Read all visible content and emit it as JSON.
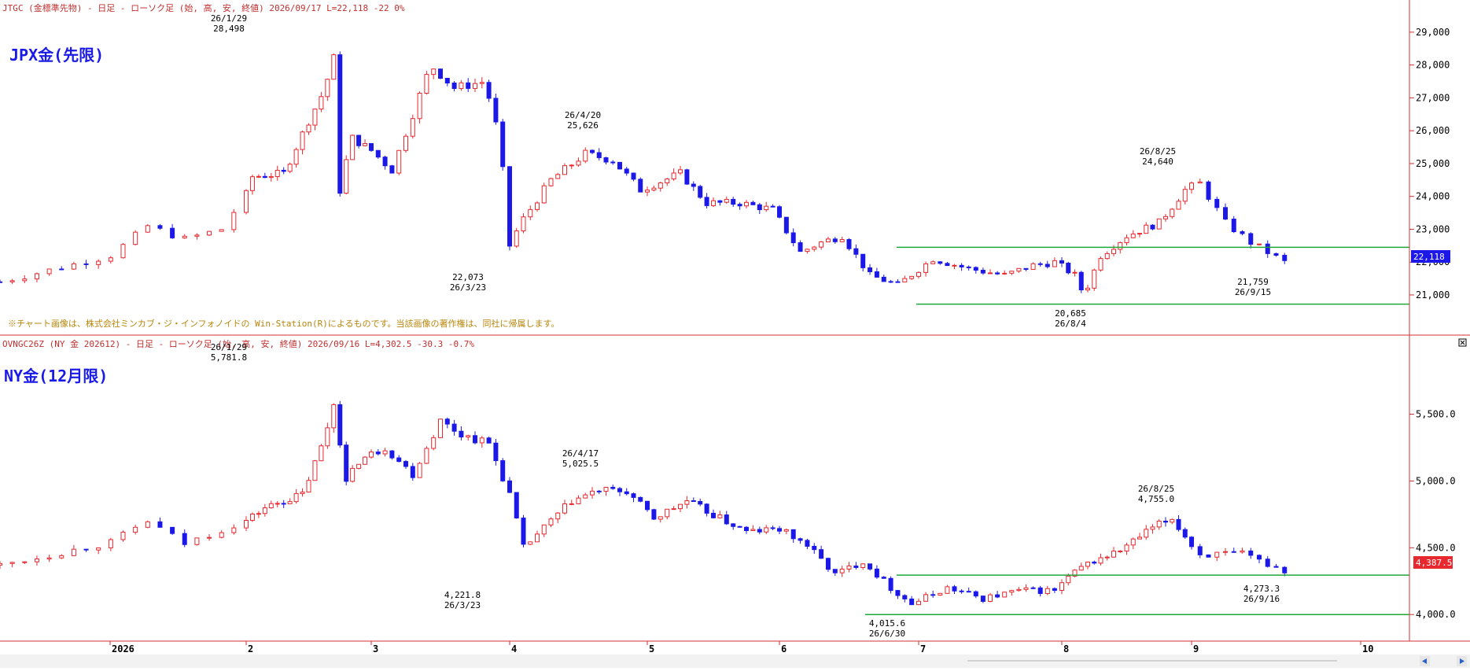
{
  "colors": {
    "up": "#e8282f",
    "down": "#1b18e8",
    "support": "#1fa83a",
    "divider": "#d23232",
    "title": "#1a1ae6",
    "header": "#c03030",
    "label": "#000000",
    "background": "#ffffff"
  },
  "icons": {
    "close": "close-icon",
    "scroll_left": "arrow-left-icon",
    "scroll_right": "arrow-right-icon"
  },
  "top": {
    "header": "JTGC (金標準先物) - 日足 - ローソク足 (始, 高, 安, 終値)  2026/09/17  L=22,118  -22   0%",
    "title": "JPX金(先限)",
    "copyright": "※チャート画像は、株式会社ミンカブ・ジ・インフォノイドの Win-Station(R)によるものです。当該画像の著作権は、同社に帰属します。",
    "last_value": "22,118",
    "y_ticks": [
      "21,000",
      "22,000",
      "23,000",
      "24,000",
      "25,000",
      "26,000",
      "27,000",
      "28,000",
      "29,000"
    ],
    "annotations": [
      {
        "date": "26/1/29",
        "value": "28,498"
      },
      {
        "date": "26/3/23",
        "value": "22,073"
      },
      {
        "date": "26/4/20",
        "value": "25,626"
      },
      {
        "date": "26/8/4",
        "value": "20,685"
      },
      {
        "date": "26/8/25",
        "value": "24,640"
      },
      {
        "date": "26/9/15",
        "value": "21,759"
      }
    ]
  },
  "bottom": {
    "header": "OVNGC26Z (NY 金 202612) - 日足 - ローソク足 (始, 高, 安, 終値)  2026/09/16  L=4,302.5  -30.3  -0.7%",
    "title": "NY金(12月限)",
    "last_value": "4,387.5",
    "y_ticks": [
      "4,000.0",
      "4,500.0",
      "5,000.0",
      "5,500.0"
    ],
    "annotations": [
      {
        "date": "26/1/29",
        "value": "5,781.8"
      },
      {
        "date": "26/3/23",
        "value": "4,221.8"
      },
      {
        "date": "26/4/17",
        "value": "5,025.5"
      },
      {
        "date": "26/6/30",
        "value": "4,015.6"
      },
      {
        "date": "26/8/25",
        "value": "4,755.0"
      },
      {
        "date": "26/9/16",
        "value": "4,273.3"
      }
    ]
  },
  "x_axis": {
    "labels": [
      "2026",
      "2",
      "3",
      "4",
      "5",
      "6",
      "7",
      "8",
      "9",
      "10"
    ]
  },
  "chart_data": [
    {
      "type": "candlestick",
      "title": "JPX金(先限)",
      "ylim": [
        20400,
        29500
      ],
      "y_ticks": [
        21000,
        22000,
        23000,
        24000,
        25000,
        26000,
        27000,
        28000,
        29000
      ],
      "x_months": [
        "2026-01",
        "2026-02",
        "2026-03",
        "2026-04",
        "2026-05",
        "2026-06",
        "2026-07",
        "2026-08",
        "2026-09",
        "2026-10"
      ],
      "last": 22118,
      "labeled_points": [
        {
          "date": "2026-01-29",
          "value": 28498,
          "kind": "high"
        },
        {
          "date": "2026-03-23",
          "value": 22073,
          "kind": "low"
        },
        {
          "date": "2026-04-20",
          "value": 25626,
          "kind": "high"
        },
        {
          "date": "2026-08-04",
          "value": 20685,
          "kind": "low"
        },
        {
          "date": "2026-08-25",
          "value": 24640,
          "kind": "high"
        },
        {
          "date": "2026-09-15",
          "value": 21759,
          "kind": "low"
        }
      ],
      "support_lines": [
        {
          "value": 22450,
          "from": "2026-07",
          "to": "2026-10"
        },
        {
          "value": 20720,
          "from": "2026-07",
          "to": "2026-10"
        }
      ],
      "trend_points": [
        {
          "m": 0.0,
          "v": 21400
        },
        {
          "m": 0.45,
          "v": 22200
        },
        {
          "m": 0.6,
          "v": 23100
        },
        {
          "m": 0.75,
          "v": 22700
        },
        {
          "m": 0.9,
          "v": 23000
        },
        {
          "m": 1.05,
          "v": 24600
        },
        {
          "m": 1.3,
          "v": 24700
        },
        {
          "m": 1.5,
          "v": 26300
        },
        {
          "m": 1.62,
          "v": 27200
        },
        {
          "m": 1.7,
          "v": 28200
        },
        {
          "m": 1.74,
          "v": 24000
        },
        {
          "m": 1.84,
          "v": 25800
        },
        {
          "m": 2.0,
          "v": 25400
        },
        {
          "m": 2.15,
          "v": 24800
        },
        {
          "m": 2.3,
          "v": 26500
        },
        {
          "m": 2.43,
          "v": 28000
        },
        {
          "m": 2.6,
          "v": 27300
        },
        {
          "m": 2.82,
          "v": 27500
        },
        {
          "m": 2.93,
          "v": 25700
        },
        {
          "m": 3.0,
          "v": 22500
        },
        {
          "m": 3.08,
          "v": 23200
        },
        {
          "m": 3.3,
          "v": 24500
        },
        {
          "m": 3.55,
          "v": 25300
        },
        {
          "m": 3.75,
          "v": 25100
        },
        {
          "m": 3.95,
          "v": 24200
        },
        {
          "m": 4.25,
          "v": 24700
        },
        {
          "m": 4.45,
          "v": 23800
        },
        {
          "m": 4.7,
          "v": 23800
        },
        {
          "m": 4.95,
          "v": 23600
        },
        {
          "m": 5.15,
          "v": 22300
        },
        {
          "m": 5.3,
          "v": 22600
        },
        {
          "m": 5.45,
          "v": 22800
        },
        {
          "m": 5.65,
          "v": 21600
        },
        {
          "m": 5.85,
          "v": 21300
        },
        {
          "m": 6.1,
          "v": 22100
        },
        {
          "m": 6.35,
          "v": 21800
        },
        {
          "m": 6.6,
          "v": 21600
        },
        {
          "m": 6.8,
          "v": 21900
        },
        {
          "m": 6.95,
          "v": 22000
        },
        {
          "m": 7.1,
          "v": 21600
        },
        {
          "m": 7.17,
          "v": 21000
        },
        {
          "m": 7.3,
          "v": 22200
        },
        {
          "m": 7.5,
          "v": 22800
        },
        {
          "m": 7.75,
          "v": 23200
        },
        {
          "m": 7.95,
          "v": 24200
        },
        {
          "m": 8.05,
          "v": 24400
        },
        {
          "m": 8.2,
          "v": 23200
        },
        {
          "m": 8.35,
          "v": 22600
        },
        {
          "m": 8.55,
          "v": 22000
        }
      ]
    },
    {
      "type": "candlestick",
      "title": "NY金(12月限)",
      "ylim": [
        3860,
        5980
      ],
      "y_ticks": [
        4000,
        4500,
        5000,
        5500
      ],
      "x_months": [
        "2026-01",
        "2026-02",
        "2026-03",
        "2026-04",
        "2026-05",
        "2026-06",
        "2026-07",
        "2026-08",
        "2026-09",
        "2026-10"
      ],
      "last": 4387.5,
      "labeled_points": [
        {
          "date": "2026-01-29",
          "value": 5781.8,
          "kind": "high"
        },
        {
          "date": "2026-03-23",
          "value": 4221.8,
          "kind": "low"
        },
        {
          "date": "2026-04-17",
          "value": 5025.5,
          "kind": "high"
        },
        {
          "date": "2026-06-30",
          "value": 4015.6,
          "kind": "low"
        },
        {
          "date": "2026-08-25",
          "value": 4755.0,
          "kind": "high"
        },
        {
          "date": "2026-09-16",
          "value": 4273.3,
          "kind": "low"
        }
      ],
      "support_lines": [
        {
          "value": 4295,
          "from": "2026-07",
          "to": "2026-10"
        },
        {
          "value": 4000,
          "from": "2026-07",
          "to": "2026-10"
        }
      ],
      "trend_points": [
        {
          "m": 0.0,
          "v": 4370
        },
        {
          "m": 0.45,
          "v": 4540
        },
        {
          "m": 0.6,
          "v": 4700
        },
        {
          "m": 0.75,
          "v": 4530
        },
        {
          "m": 0.95,
          "v": 4670
        },
        {
          "m": 1.15,
          "v": 4800
        },
        {
          "m": 1.45,
          "v": 4900
        },
        {
          "m": 1.62,
          "v": 5300
        },
        {
          "m": 1.72,
          "v": 5650
        },
        {
          "m": 1.78,
          "v": 4950
        },
        {
          "m": 1.9,
          "v": 5150
        },
        {
          "m": 2.1,
          "v": 5250
        },
        {
          "m": 2.3,
          "v": 5050
        },
        {
          "m": 2.5,
          "v": 5450
        },
        {
          "m": 2.65,
          "v": 5350
        },
        {
          "m": 2.85,
          "v": 5280
        },
        {
          "m": 3.0,
          "v": 4900
        },
        {
          "m": 3.1,
          "v": 4500
        },
        {
          "m": 3.25,
          "v": 4650
        },
        {
          "m": 3.45,
          "v": 4850
        },
        {
          "m": 3.65,
          "v": 4930
        },
        {
          "m": 3.85,
          "v": 4920
        },
        {
          "m": 4.05,
          "v": 4720
        },
        {
          "m": 4.3,
          "v": 4850
        },
        {
          "m": 4.55,
          "v": 4720
        },
        {
          "m": 4.75,
          "v": 4620
        },
        {
          "m": 5.0,
          "v": 4640
        },
        {
          "m": 5.2,
          "v": 4520
        },
        {
          "m": 5.4,
          "v": 4300
        },
        {
          "m": 5.6,
          "v": 4400
        },
        {
          "m": 5.8,
          "v": 4200
        },
        {
          "m": 5.95,
          "v": 4080
        },
        {
          "m": 6.2,
          "v": 4200
        },
        {
          "m": 6.45,
          "v": 4120
        },
        {
          "m": 6.7,
          "v": 4180
        },
        {
          "m": 6.95,
          "v": 4180
        },
        {
          "m": 7.05,
          "v": 4280
        },
        {
          "m": 7.2,
          "v": 4380
        },
        {
          "m": 7.45,
          "v": 4480
        },
        {
          "m": 7.7,
          "v": 4650
        },
        {
          "m": 7.85,
          "v": 4720
        },
        {
          "m": 8.05,
          "v": 4450
        },
        {
          "m": 8.3,
          "v": 4450
        },
        {
          "m": 8.55,
          "v": 4330
        }
      ]
    }
  ]
}
